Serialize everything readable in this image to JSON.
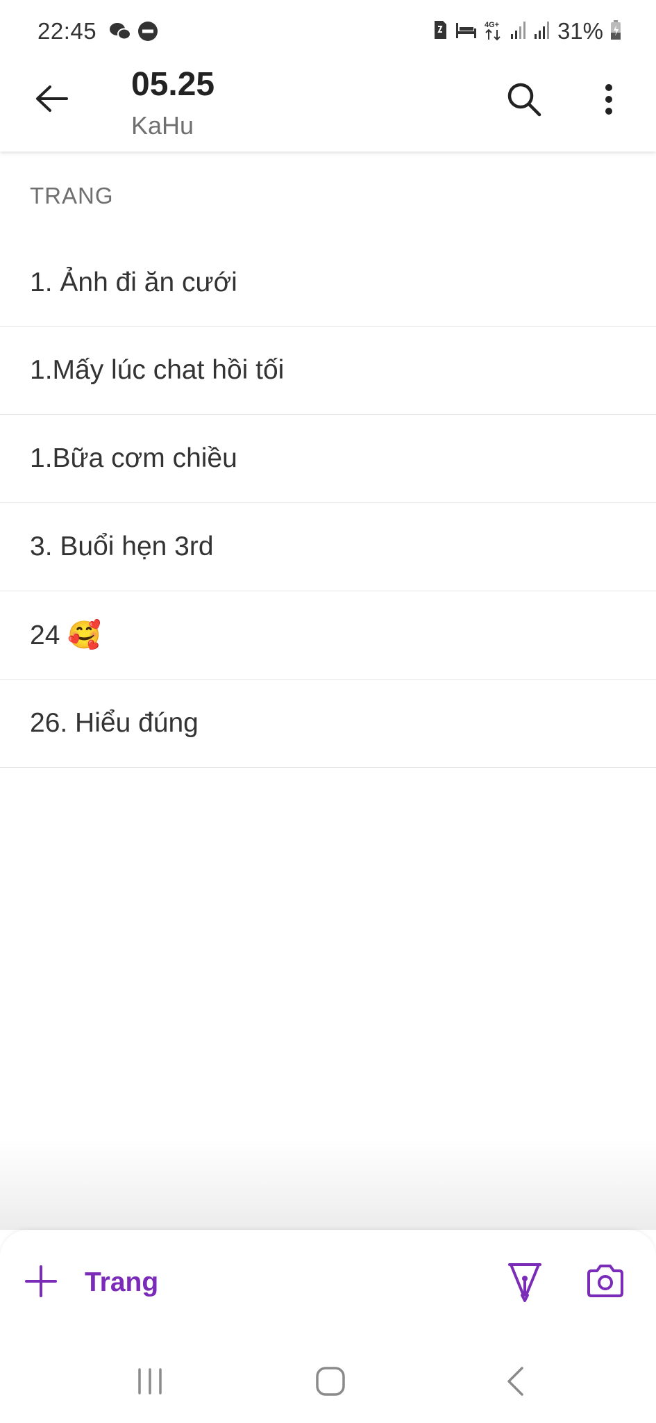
{
  "status_bar": {
    "time": "22:45",
    "battery_percent": "31%",
    "left_icons": [
      "wechat-icon",
      "do-not-disturb-icon"
    ],
    "right_icons": [
      "sim-card-icon",
      "sleep-mode-icon",
      "4g-data-icon",
      "signal-icon",
      "signal-icon",
      "battery-charging-icon"
    ]
  },
  "app_bar": {
    "title": "05.25",
    "subtitle": "KaHu"
  },
  "section": {
    "header": "TRANG"
  },
  "pages": [
    {
      "label": "1. Ảnh đi ăn cưới"
    },
    {
      "label": "1.Mấy lúc chat hồi tối"
    },
    {
      "label": "1.Bữa cơm chiều"
    },
    {
      "label": "3. Buổi hẹn 3rd"
    },
    {
      "label": "24 🥰"
    },
    {
      "label": "26. Hiểu đúng"
    }
  ],
  "toolbar": {
    "add_label": "Trang",
    "accent_color": "#7a2bb8"
  }
}
